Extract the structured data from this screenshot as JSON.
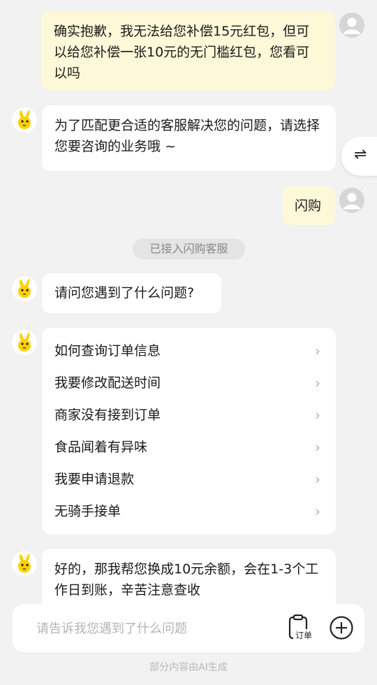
{
  "messages": {
    "m1_user": "确实抱歉，我无法给您补偿15元红包，但可以给您补偿一张10元的无门槛红包，您看可以吗",
    "m2_bot": "为了匹配更合适的客服解决您的问题，请选择您要咨询的业务哦 ~",
    "m3_user": "闪购",
    "system": "已接入闪购客服",
    "m4_bot": "请问您遇到了什么问题?",
    "m5_bot": "好的，那我帮您换成10元余额，会在1-3个工作日到账，辛苦注意查收"
  },
  "menu": {
    "items": [
      {
        "label": "如何查询订单信息"
      },
      {
        "label": "我要修改配送时间"
      },
      {
        "label": "商家没有接到订单"
      },
      {
        "label": "食品闻着有异味"
      },
      {
        "label": "我要申请退款"
      },
      {
        "label": "无骑手接单"
      }
    ]
  },
  "switch_glyph": "⇌",
  "input": {
    "placeholder": "请告诉我您遇到了什么问题"
  },
  "order_label": "订单",
  "footer": "部分内容由AI生成",
  "icons": {
    "bot_avatar": "yellow-rabbit-mascot-icon",
    "user_avatar": "default-user-icon",
    "order": "order-icon",
    "plus": "plus-circle-icon",
    "chevron": "chevron-right-icon",
    "switch": "switch-arrows-icon"
  },
  "colors": {
    "user_bubble": "#fdf8d8",
    "bot_bubble": "#ffffff",
    "background": "#f2f2f2",
    "mascot_yellow": "#ffd100"
  }
}
